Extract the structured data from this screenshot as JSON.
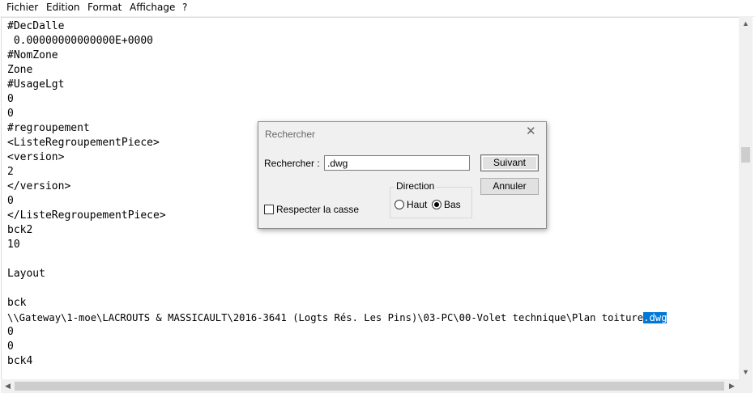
{
  "menu": [
    "Fichier",
    "Edition",
    "Format",
    "Affichage",
    "?"
  ],
  "editor": {
    "lines": [
      "#DecDalle",
      " 0.00000000000000E+0000",
      "#NomZone",
      "Zone",
      "#UsageLgt",
      "0",
      "0",
      "#regroupement",
      "<ListeRegroupementPiece>",
      "<version>",
      "2",
      "</version>",
      "0",
      "</ListeRegroupementPiece>",
      "bck2",
      "10",
      "",
      "Layout",
      "",
      "bck",
      "\\\\Gateway\\1-moe\\LACROUTS & MASSICAULT\\2016-3641 (Logts Rés. Les Pins)\\03-PC\\00-Volet technique\\Plan toiture",
      "0",
      "0",
      "bck4"
    ],
    "selected_text": ".dwg"
  },
  "dialog": {
    "title": "Rechercher",
    "search_label": "Rechercher :",
    "search_value": ".dwg",
    "next_button": "Suivant",
    "cancel_button": "Annuler",
    "match_case_label": "Respecter la casse",
    "direction_label": "Direction",
    "up_label": "Haut",
    "down_label": "Bas",
    "direction_selected": "Bas"
  }
}
